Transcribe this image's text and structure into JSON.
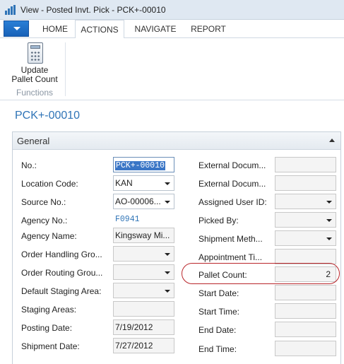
{
  "window": {
    "title": "View - Posted Invt. Pick - PCK+-00010"
  },
  "tabs": [
    "HOME",
    "ACTIONS",
    "NAVIGATE",
    "REPORT"
  ],
  "ribbon": {
    "button_label_1": "Update",
    "button_label_2": "Pallet Count",
    "group": "Functions"
  },
  "page": {
    "title": "PCK+-00010"
  },
  "general": {
    "title": "General",
    "left": {
      "no": {
        "label": "No.:",
        "value": "PCK+-00010"
      },
      "location_code": {
        "label": "Location Code:",
        "value": "KAN"
      },
      "source_no": {
        "label": "Source No.:",
        "value": "AO-00006..."
      },
      "agency_no": {
        "label": "Agency No.:",
        "value": "F0941"
      },
      "agency_name": {
        "label": "Agency Name:",
        "value": "Kingsway Mi..."
      },
      "order_handling_group": {
        "label": "Order Handling Gro...",
        "value": ""
      },
      "order_routing_group": {
        "label": "Order Routing Grou...",
        "value": ""
      },
      "default_staging_area": {
        "label": "Default Staging Area:",
        "value": ""
      },
      "staging_areas": {
        "label": "Staging Areas:",
        "value": ""
      },
      "posting_date": {
        "label": "Posting Date:",
        "value": "7/19/2012"
      },
      "shipment_date": {
        "label": "Shipment Date:",
        "value": "7/27/2012"
      }
    },
    "right": {
      "external_doc_1": {
        "label": "External Docum...",
        "value": ""
      },
      "external_doc_2": {
        "label": "External Docum...",
        "value": ""
      },
      "assigned_user_id": {
        "label": "Assigned User ID:",
        "value": ""
      },
      "picked_by": {
        "label": "Picked By:",
        "value": ""
      },
      "shipment_method": {
        "label": "Shipment Meth...",
        "value": ""
      },
      "appointment_time": {
        "label": "Appointment Ti...",
        "value": ""
      },
      "pallet_count": {
        "label": "Pallet Count:",
        "value": "2"
      },
      "start_date": {
        "label": "Start Date:",
        "value": ""
      },
      "start_time": {
        "label": "Start Time:",
        "value": ""
      },
      "end_date": {
        "label": "End Date:",
        "value": ""
      },
      "end_time": {
        "label": "End Time:",
        "value": ""
      }
    }
  },
  "colors": {
    "accent": "#2f74b7",
    "highlight": "#b9262b",
    "app_button": "#1f6fc8"
  },
  "icons": [
    "app-icon",
    "calculator-icon",
    "dropdown-arrow-icon",
    "collapse-icon"
  ]
}
